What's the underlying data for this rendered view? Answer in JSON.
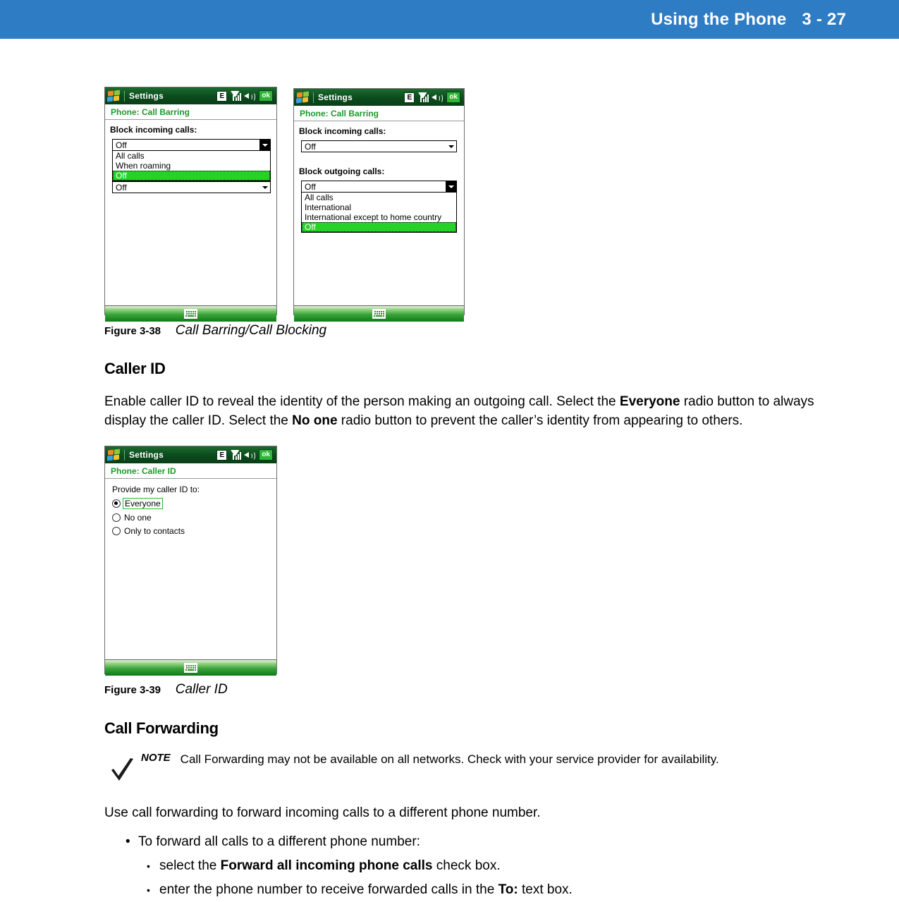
{
  "page_header": {
    "title": "Using the Phone",
    "page_number": "3 - 27",
    "background_color": "#2e7cc4",
    "text_color": "#ffffff"
  },
  "colors": {
    "titlebar_green": "#0b4a1c",
    "subtitle_green": "#1a9a2a",
    "selection_green": "#27d227",
    "footer_green": "#0f7a17",
    "ok_green": "#2cb737"
  },
  "figures": [
    {
      "number": "Figure 3-38",
      "title": "Call Barring/Call Blocking"
    },
    {
      "number": "Figure 3-39",
      "title": "Caller ID"
    }
  ],
  "device_left": {
    "titlebar": {
      "app_name": "Settings",
      "status_icons": [
        "E",
        "signal-icon",
        "speaker-icon"
      ],
      "edge_indicator": "E",
      "ok_button": "ok"
    },
    "subtitle": "Phone: Call Barring",
    "field_label": "Block incoming calls:",
    "combo_value": "Off",
    "dropdown_options": [
      "All calls",
      "When roaming",
      "Off"
    ],
    "dropdown_selected": "Off",
    "second_combo_value": "Off"
  },
  "device_right": {
    "titlebar": {
      "app_name": "Settings",
      "edge_indicator": "E",
      "ok_button": "ok"
    },
    "subtitle": "Phone: Call Barring",
    "incoming_label": "Block incoming calls:",
    "incoming_value": "Off",
    "outgoing_label": "Block outgoing calls:",
    "outgoing_value": "Off",
    "dropdown_options": [
      "All calls",
      "International",
      "International except to home country",
      "Off"
    ],
    "dropdown_selected": "Off"
  },
  "device_callerid": {
    "titlebar": {
      "app_name": "Settings",
      "edge_indicator": "E",
      "ok_button": "ok"
    },
    "subtitle": "Phone: Caller ID",
    "prompt": "Provide my caller ID to:",
    "options": [
      {
        "label": "Everyone",
        "selected": true
      },
      {
        "label": "No one",
        "selected": false
      },
      {
        "label": "Only to contacts",
        "selected": false
      }
    ]
  },
  "sections": {
    "caller_id": {
      "heading": "Caller ID",
      "paragraph_line1_a": "Enable caller ID to reveal the identity of the person making an outgoing call. Select the ",
      "paragraph_bold1": "Everyone",
      "paragraph_line1_b": " radio button to always display the caller ID. Select the ",
      "paragraph_bold2": "No one",
      "paragraph_line1_c": " radio button to prevent the caller’s identity from appearing to others."
    },
    "call_forwarding": {
      "heading": "Call Forwarding",
      "note_label": "NOTE",
      "note_text": "Call Forwarding may not be available on all networks. Check with your service provider for availability.",
      "intro": "Use call forwarding to forward incoming calls to a different phone number.",
      "bullet1": "To forward all calls to a different phone number:",
      "sub_bullet1_a": "select the ",
      "sub_bullet1_bold": "Forward all incoming phone calls",
      "sub_bullet1_b": " check box.",
      "sub_bullet2_a": "enter the phone number to receive forwarded calls in the ",
      "sub_bullet2_bold": "To:",
      "sub_bullet2_b": " text box."
    }
  }
}
